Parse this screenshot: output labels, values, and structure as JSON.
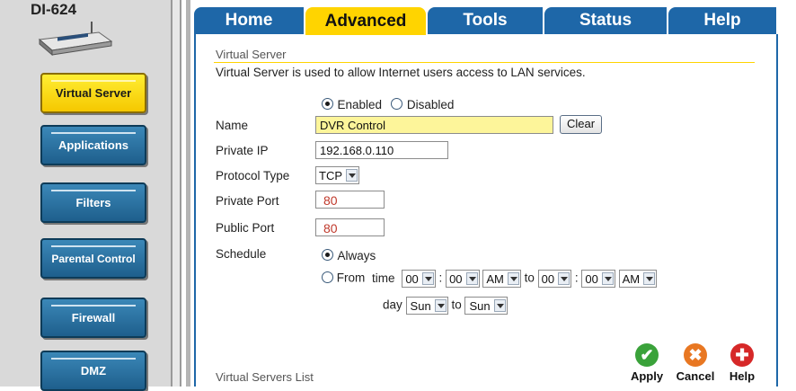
{
  "device": {
    "model": "DI-624"
  },
  "sidebar": {
    "items": [
      {
        "label": "Virtual Server",
        "active": true
      },
      {
        "label": "Applications"
      },
      {
        "label": "Filters"
      },
      {
        "label": "Parental Control"
      },
      {
        "label": "Firewall"
      },
      {
        "label": "DMZ"
      }
    ]
  },
  "tabs": [
    {
      "label": "Home"
    },
    {
      "label": "Advanced",
      "active": true
    },
    {
      "label": "Tools"
    },
    {
      "label": "Status"
    },
    {
      "label": "Help"
    }
  ],
  "section": {
    "title": "Virtual Server",
    "description": "Virtual Server is used to allow Internet users access to LAN services."
  },
  "form": {
    "enabled_label": "Enabled",
    "disabled_label": "Disabled",
    "enabled": true,
    "name_label": "Name",
    "name_value": "DVR Control",
    "clear_label": "Clear",
    "private_ip_label": "Private IP",
    "private_ip_value": "192.168.0.110",
    "protocol_label": "Protocol Type",
    "protocol_value": "TCP",
    "private_port_label": "Private Port",
    "private_port_value": "80",
    "public_port_label": "Public Port",
    "public_port_value": "80",
    "schedule_label": "Schedule",
    "always_label": "Always",
    "schedule_always": true,
    "from_label": "From",
    "time_label": "time",
    "to_label": "to",
    "colon": ":",
    "day_label": "day",
    "from_hour": "00",
    "from_min": "00",
    "from_ampm": "AM",
    "to_hour": "00",
    "to_min": "00",
    "to_ampm": "AM",
    "from_day": "Sun",
    "to_day": "Sun"
  },
  "actions": {
    "apply": "Apply",
    "cancel": "Cancel",
    "help": "Help"
  },
  "list": {
    "title": "Virtual Servers List"
  },
  "colors": {
    "tab_blue": "#1e67a8",
    "tab_active": "#ffd400",
    "nav_blue": "#1e5f8c",
    "apply_green": "#3aa23a",
    "cancel_orange": "#e87722",
    "help_red": "#d62828"
  }
}
